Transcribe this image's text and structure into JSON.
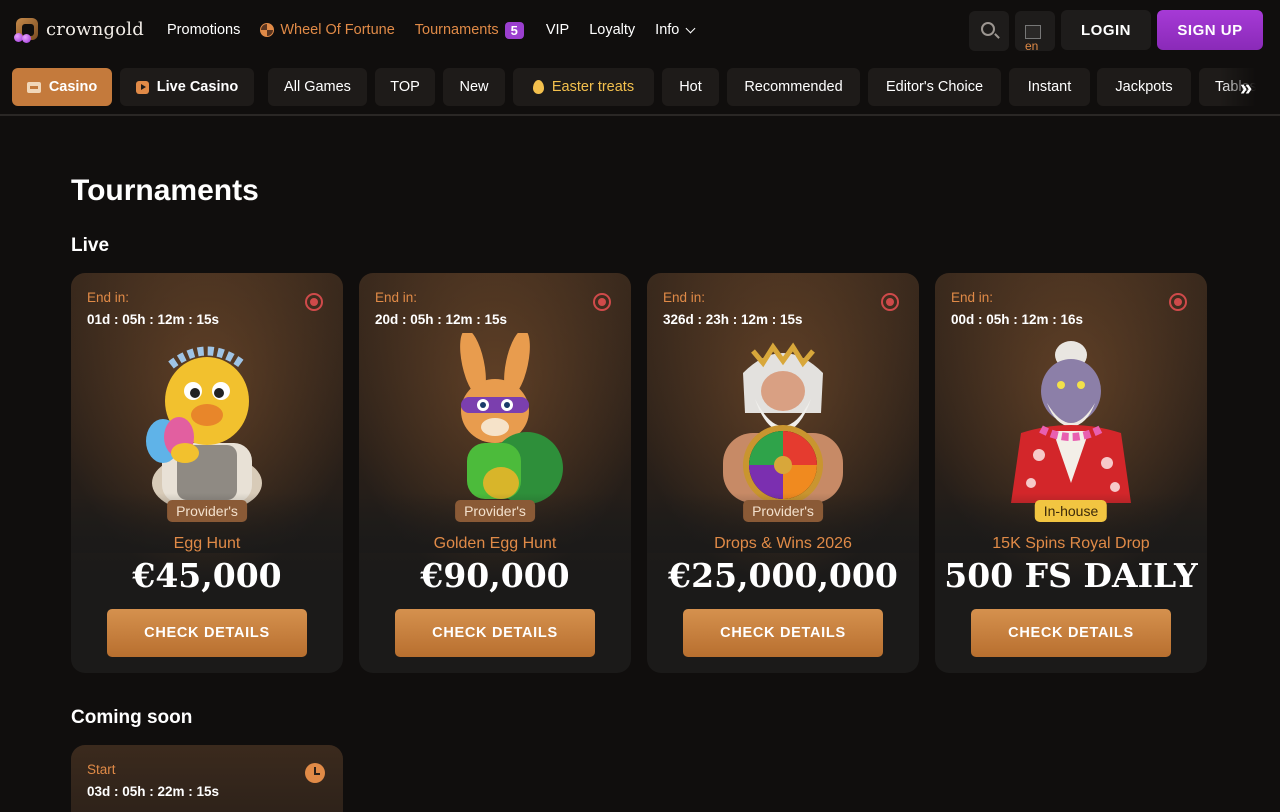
{
  "brand": {
    "name": "crowngold"
  },
  "nav": {
    "promotions": "Promotions",
    "wheel": "Wheel Of Fortune",
    "tournaments": "Tournaments",
    "tournaments_count": "5",
    "vip": "VIP",
    "loyalty": "Loyalty",
    "info": "Info"
  },
  "header": {
    "lang": "en",
    "login": "LOGIN",
    "signup": "SIGN UP"
  },
  "categories": {
    "casino": "Casino",
    "live_casino": "Live Casino",
    "all_games": "All Games",
    "top": "TOP",
    "new": "New",
    "easter": "Easter treats",
    "hot": "Hot",
    "recommended": "Recommended",
    "editors_choice": "Editor's Choice",
    "instant": "Instant",
    "jackpots": "Jackpots",
    "tables": "Tables"
  },
  "page": {
    "title": "Tournaments",
    "live_heading": "Live",
    "soon_heading": "Coming soon"
  },
  "live_tournaments": [
    {
      "end_label": "End in:",
      "timer": "01d : 05h : 12m : 15s",
      "type": "Provider's",
      "name": "Egg Hunt",
      "prize": "€45,000",
      "cta": "CHECK DETAILS"
    },
    {
      "end_label": "End in:",
      "timer": "20d : 05h : 12m : 15s",
      "type": "Provider's",
      "name": "Golden Egg Hunt",
      "prize": "€90,000",
      "cta": "CHECK DETAILS"
    },
    {
      "end_label": "End in:",
      "timer": "326d : 23h : 12m : 15s",
      "type": "Provider's",
      "name": "Drops & Wins 2026",
      "prize": "€25,000,000",
      "cta": "CHECK DETAILS"
    },
    {
      "end_label": "End in:",
      "timer": "00d : 05h : 12m : 16s",
      "type": "In-house",
      "name": "15K Spins Royal Drop",
      "prize": "500 FS DAILY",
      "cta": "CHECK DETAILS"
    }
  ],
  "coming_soon": [
    {
      "start_label": "Start",
      "timer": "03d : 05h : 22m : 15s"
    }
  ],
  "colors": {
    "accent": "#e08a47",
    "signup": "#9b3fcf",
    "live_dot": "#cf4a4a",
    "inhouse": "#f2c541"
  }
}
